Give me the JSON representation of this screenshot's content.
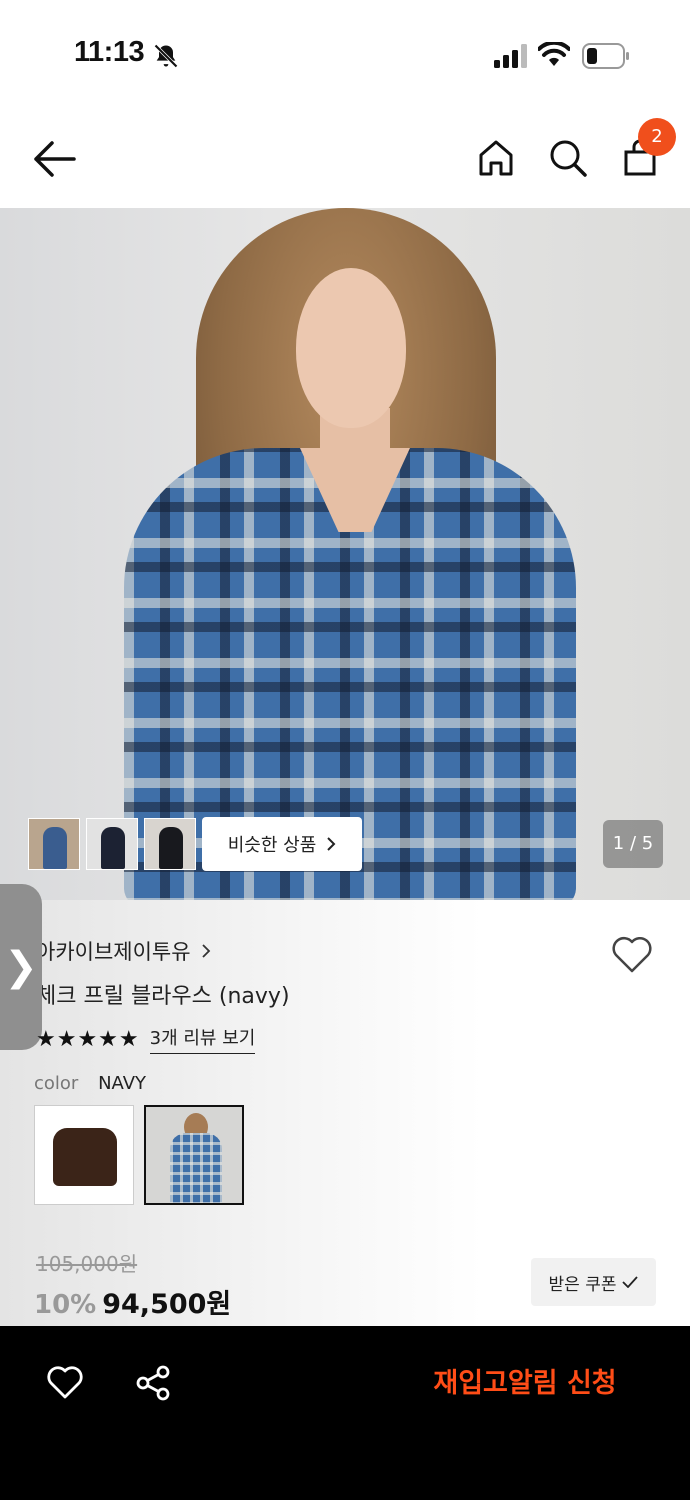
{
  "status_bar": {
    "time": "11:13"
  },
  "header": {
    "cart_count": "2"
  },
  "gallery": {
    "similar_label": "비슷한 상품",
    "page_indicator": "1 / 5"
  },
  "product": {
    "brand": "아카이브제이투유",
    "name": "체크 프릴 블라우스 (navy)",
    "rating": 5,
    "stars": "★★★★★",
    "review_link": "3개 리뷰 보기",
    "color_label": "color",
    "color_value": "NAVY",
    "original_price": "105,000원",
    "discount": "10%",
    "price": "94,500원",
    "coupon_label": "받은 쿠폰"
  },
  "side_tab": {
    "glyph": "❯"
  },
  "bottom_bar": {
    "restock_label": "재입고알림 신청"
  },
  "colors": {
    "accent": "#f04f1c",
    "restock_text": "#ff4d17",
    "bottom_bg": "#000000"
  }
}
